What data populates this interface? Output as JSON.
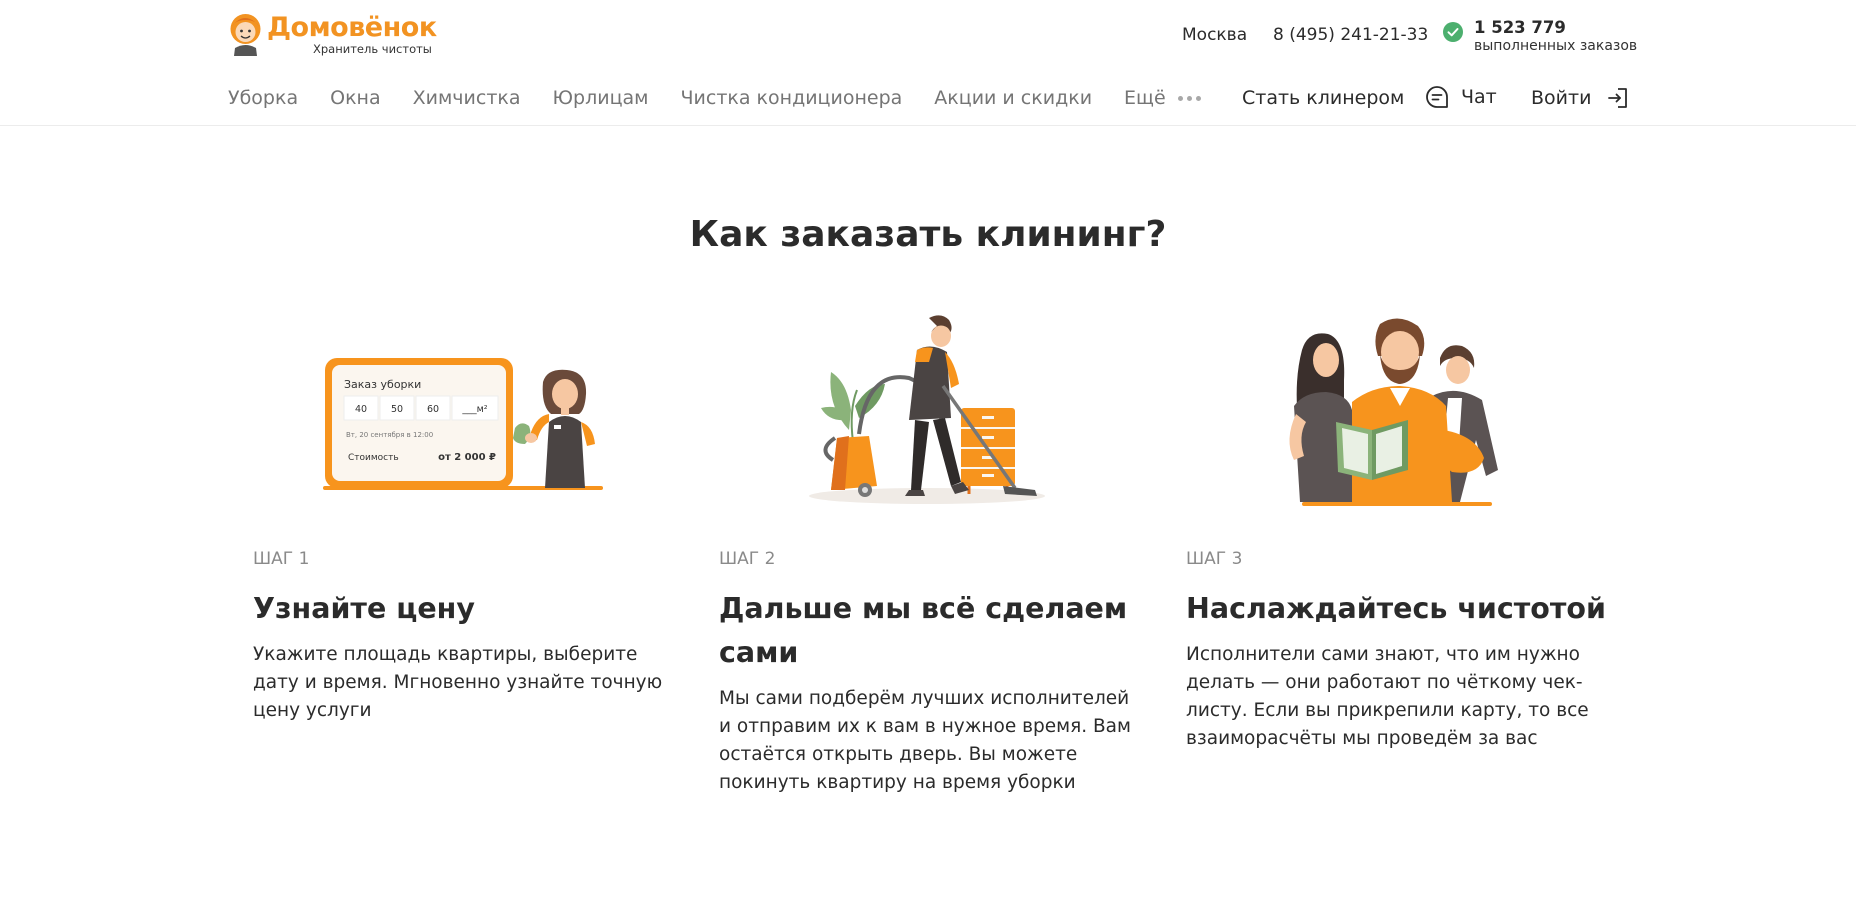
{
  "header": {
    "logo": {
      "name": "Домовёнок",
      "tagline": "Хранитель чистоты"
    },
    "city": "Москва",
    "phone": "8 (495) 241-21-33",
    "orders": {
      "count": "1 523 779",
      "label": "выполненных заказов"
    },
    "nav": [
      {
        "label": "Уборка"
      },
      {
        "label": "Окна"
      },
      {
        "label": "Химчистка"
      },
      {
        "label": "Юрлицам"
      },
      {
        "label": "Чистка кондиционера"
      },
      {
        "label": "Акции и скидки"
      }
    ],
    "more_label": "Ещё",
    "become_cleaner": "Стать клинером",
    "chat": "Чат",
    "login": "Войти"
  },
  "section": {
    "title": "Как заказать клининг?",
    "steps": [
      {
        "label": "ШАГ 1",
        "title": "Узнайте цену",
        "text": "Укажите площадь квартиры, выберите дату и время. Мгновенно узнайте точную цену услуги",
        "card": {
          "title": "Заказ уборки",
          "options": [
            "40",
            "50",
            "60",
            "___м²"
          ],
          "date": "Вт, 20 сентября в 12:00",
          "cost_label": "Стоимость",
          "cost_value": "от 2 000 ₽"
        }
      },
      {
        "label": "ШАГ 2",
        "title": "Дальше мы всё сделаем сами",
        "text": "Мы сами подберём лучших исполнителей и отправим их к вам в нужное время. Вам остаётся открыть дверь. Вы можете покинуть квартиру на время уборки"
      },
      {
        "label": "ШАГ 3",
        "title": "Наслаждайтесь чистотой",
        "text": "Исполнители сами знают, что им нужно делать — они работают по чёткому чек-листу. Если вы прикрепили карту, то все взаиморасчёты мы проведём за вас"
      }
    ]
  },
  "colors": {
    "brand": "#f29322",
    "check": "#4caf6e",
    "text": "#2b2b2b",
    "muted": "#757575"
  },
  "icons": [
    "mascot-logo-icon",
    "check-circle-icon",
    "dots-icon",
    "chat-icon",
    "login-icon"
  ]
}
